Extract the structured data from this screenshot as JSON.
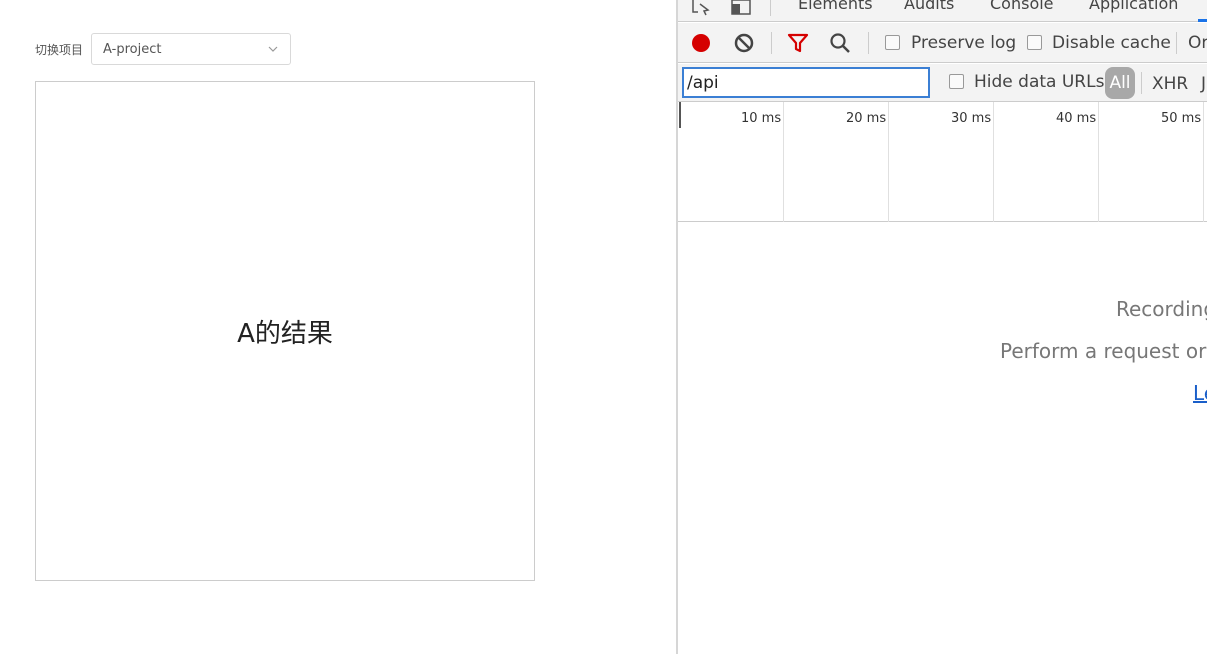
{
  "app": {
    "switch_label": "切换项目",
    "select_value": "A-project",
    "result_text": "A的结果"
  },
  "devtools": {
    "tabs": [
      "Elements",
      "Audits",
      "Console",
      "Application"
    ],
    "toolbar": {
      "preserve_log": "Preserve log",
      "disable_cache": "Disable cache",
      "online_partial": "Or"
    },
    "filter": {
      "value": "/api",
      "hide_data_urls": "Hide data URLs",
      "types": [
        "All",
        "XHR",
        "J"
      ]
    },
    "timeline_ticks": [
      "10 ms",
      "20 ms",
      "30 ms",
      "40 ms",
      "50 ms"
    ],
    "empty": {
      "line1": "Recording",
      "line2": "Perform a request or h",
      "link": "Le"
    },
    "colors": {
      "record": "#d50000",
      "filter_icon": "#d50000",
      "accent": "#1a73e8"
    }
  }
}
